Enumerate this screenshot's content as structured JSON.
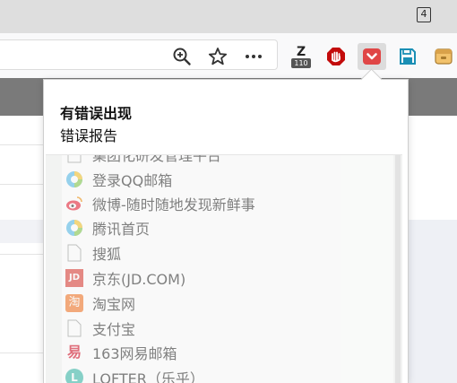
{
  "tabstrip": {
    "tab_count": "4"
  },
  "toolbar": {
    "icons": [
      "zoom-in-icon",
      "star-bookmark-icon",
      "more-menu-icon",
      "zotero-badge-icon",
      "ublock-icon",
      "pocket-icon",
      "save-icon",
      "extension-icon"
    ],
    "zotero_badge": {
      "letter": "Z",
      "count": "110"
    }
  },
  "popup": {
    "title": "有错误出现",
    "subtitle": "错误报告",
    "items": [
      {
        "label": "集团化研发管理平台",
        "icon": "generic-page-icon"
      },
      {
        "label": "登录QQ邮箱",
        "icon": "qq-icon"
      },
      {
        "label": "微博-随时随地发现新鲜事",
        "icon": "weibo-icon"
      },
      {
        "label": "腾讯首页",
        "icon": "qq-icon"
      },
      {
        "label": "搜狐",
        "icon": "generic-page-icon"
      },
      {
        "label": "京东(JD.COM)",
        "icon": "jd-icon",
        "icon_text": "JD"
      },
      {
        "label": "淘宝网",
        "icon": "taobao-icon",
        "icon_text": "淘"
      },
      {
        "label": "支付宝",
        "icon": "generic-page-icon"
      },
      {
        "label": "163网易邮箱",
        "icon": "netease-icon",
        "icon_text": "易"
      },
      {
        "label": "LOFTER（乐乎）",
        "icon": "lofter-icon",
        "icon_text": "L"
      }
    ]
  },
  "colors": {
    "accent_red": "#e04646",
    "ublock_red": "#c30b0b",
    "save_teal": "#1a8fb5",
    "jd_red": "#d9332c",
    "taobao_orange": "#f26d1a",
    "netease_red": "#d0021b",
    "lofter_teal": "#2fb4a5"
  }
}
